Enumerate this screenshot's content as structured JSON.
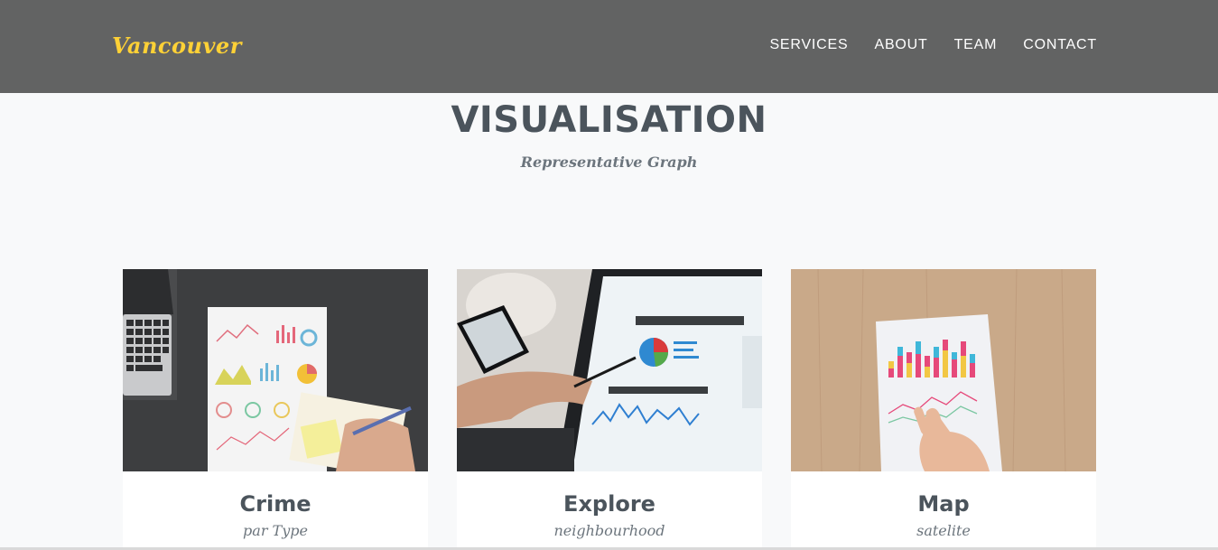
{
  "navbar": {
    "brand": "Vancouver",
    "links": [
      {
        "label": "SERVICES"
      },
      {
        "label": "ABOUT"
      },
      {
        "label": "TEAM"
      },
      {
        "label": "CONTACT"
      }
    ],
    "brand_color": "#fed136",
    "background_color": "#626363"
  },
  "section": {
    "title": "VISUALISATION",
    "subtitle": "Representative Graph"
  },
  "cards": [
    {
      "caption": "Crime",
      "subtitle": "par Type",
      "image": "laptop-with-printed-charts-photo"
    },
    {
      "caption": "Explore",
      "subtitle": "neighbourhood",
      "image": "tablet-dashboard-with-pen-photo"
    },
    {
      "caption": "Map",
      "subtitle": "satelite",
      "image": "printed-bar-chart-on-wood-photo"
    }
  ]
}
